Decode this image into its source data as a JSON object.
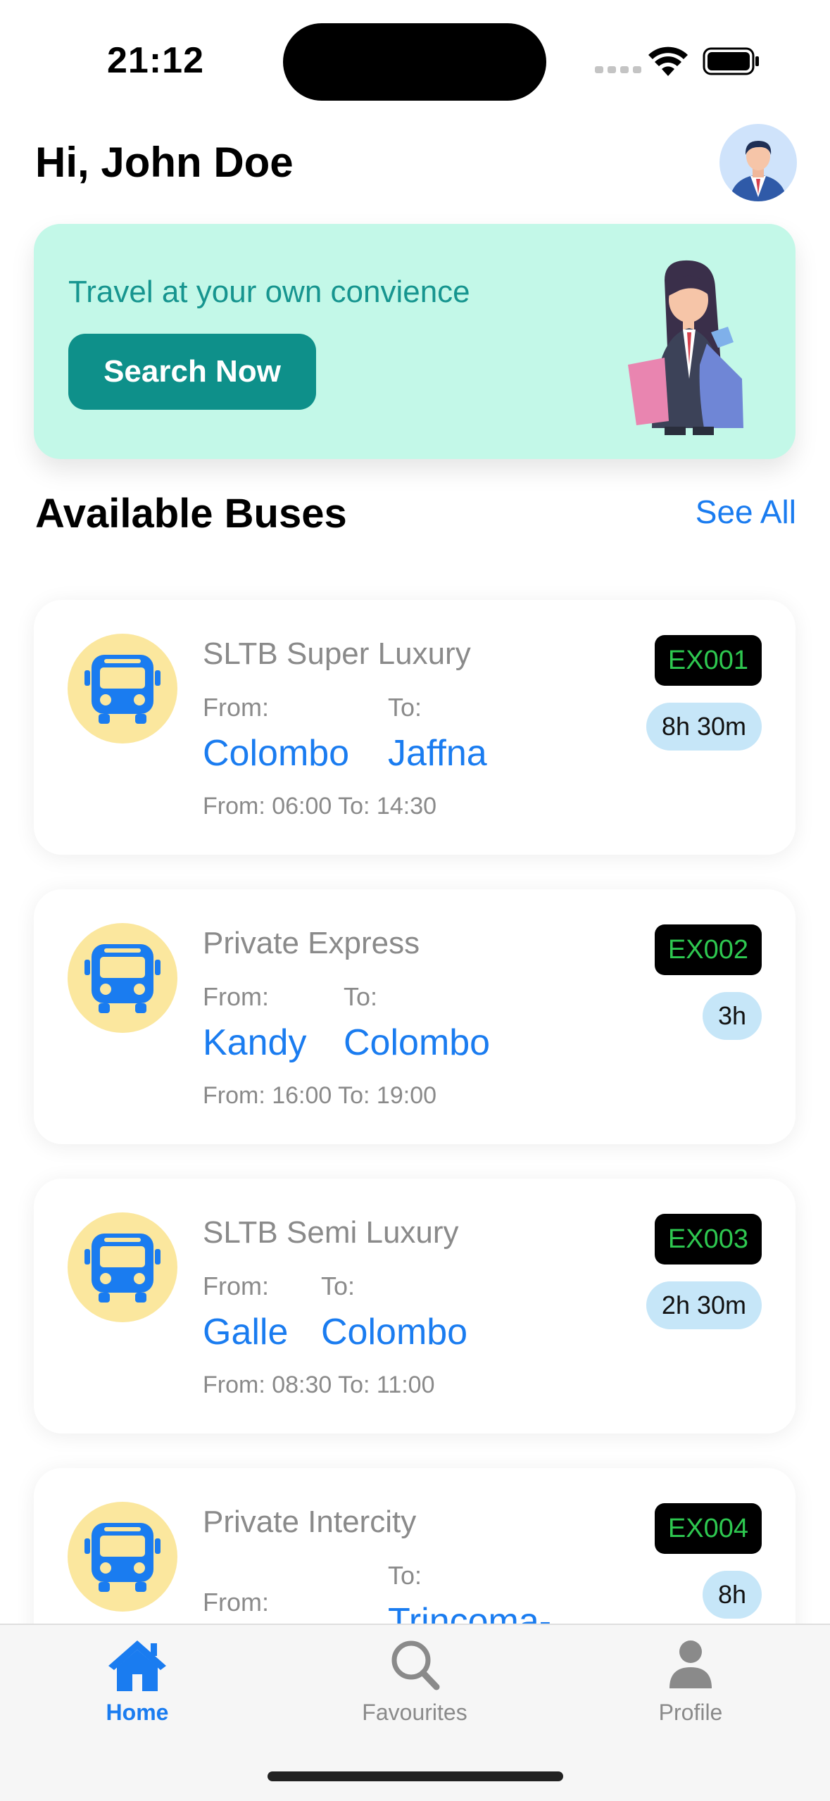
{
  "status_bar": {
    "time": "21:12"
  },
  "header": {
    "greeting": "Hi, John Doe"
  },
  "promo": {
    "text": "Travel at your own convience",
    "button_label": "Search Now"
  },
  "section": {
    "title": "Available Buses",
    "see_all": "See All"
  },
  "buses": [
    {
      "name": "SLTB Super Luxury",
      "from_label": "From:",
      "to_label": "To:",
      "from_city": "Colombo",
      "to_city": "Jaffna",
      "times": "From: 06:00  To: 14:30",
      "code": "EX001",
      "duration": "8h 30m"
    },
    {
      "name": "Private Express",
      "from_label": "From:",
      "to_label": "To:",
      "from_city": "Kandy",
      "to_city": "Colombo",
      "times": "From: 16:00  To: 19:00",
      "code": "EX002",
      "duration": "3h"
    },
    {
      "name": "SLTB Semi Luxury",
      "from_label": "From:",
      "to_label": "To:",
      "from_city": "Galle",
      "to_city": "Colombo",
      "times": "From: 08:30  To: 11:00",
      "code": "EX003",
      "duration": "2h 30m"
    },
    {
      "name": "Private Intercity",
      "from_label": "From:",
      "to_label": "To:",
      "from_city": "",
      "to_city": "Trincoma-",
      "code": "EX004",
      "duration": "8h"
    }
  ],
  "tabs": [
    {
      "label": "Home",
      "icon": "home-icon",
      "active": true
    },
    {
      "label": "Favourites",
      "icon": "search-icon",
      "active": false
    },
    {
      "label": "Profile",
      "icon": "person-icon",
      "active": false
    }
  ],
  "colors": {
    "accent": "#1a7cf0",
    "teal": "#0e908a",
    "promo_bg": "#c3f8e8",
    "code_text": "#2ec850",
    "duration_bg": "#c6e6f8",
    "bus_circle": "#fbe79e"
  }
}
